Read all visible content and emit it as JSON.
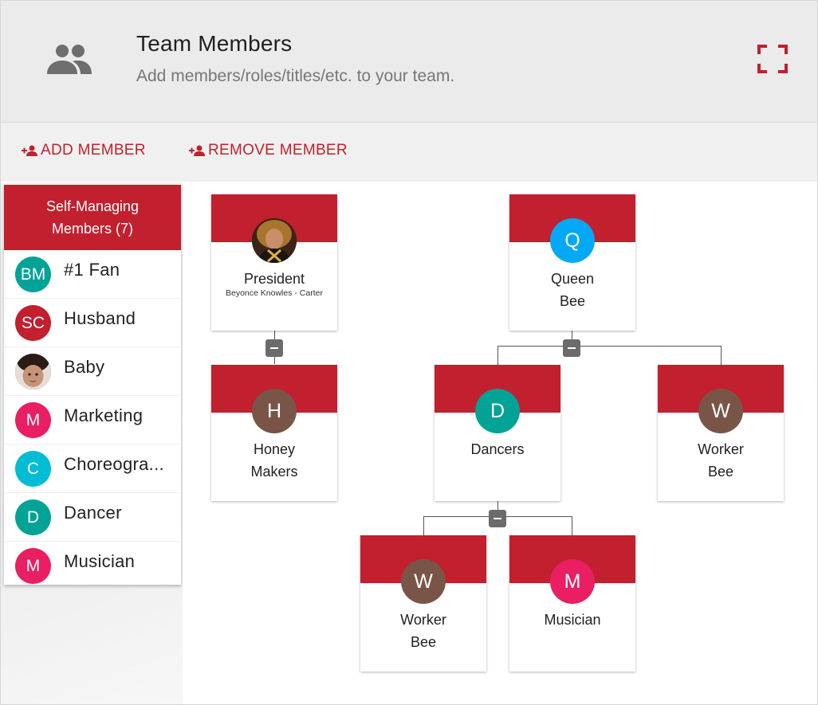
{
  "header": {
    "title": "Team Members",
    "subtitle": "Add members/roles/titles/etc. to your team.",
    "icon": "group-icon",
    "fullscreen_icon": "fullscreen-icon"
  },
  "toolbar": {
    "add_label": "ADD MEMBER",
    "remove_label": "REMOVE MEMBER"
  },
  "sidebar": {
    "title_line1": "Self-Managing",
    "title_line2": "Members (7)",
    "items": [
      {
        "initials": "BM",
        "label": "#1 Fan",
        "color": "#00a395"
      },
      {
        "initials": "SC",
        "label": "Husband",
        "color": "#c21f2f"
      },
      {
        "initials": "",
        "label": "Baby",
        "color": "#b89c8e"
      },
      {
        "initials": "M",
        "label": "Marketing",
        "color": "#e91e63"
      },
      {
        "initials": "C",
        "label": "Choreogra...",
        "color": "#00bcd4"
      },
      {
        "initials": "D",
        "label": "Dancer",
        "color": "#00a395"
      },
      {
        "initials": "M",
        "label": "Musician",
        "color": "#e91e63"
      }
    ]
  },
  "org": {
    "president": {
      "name": "President",
      "sub": "Beyonce Knowles - Carter"
    },
    "queen": {
      "initials": "Q",
      "line1": "Queen",
      "line2": "Bee",
      "color": "#03a9f4"
    },
    "honey": {
      "initials": "H",
      "line1": "Honey",
      "line2": "Makers",
      "color": "#795548"
    },
    "dancers": {
      "initials": "D",
      "line1": "Dancers",
      "color": "#00a395"
    },
    "worker1": {
      "initials": "W",
      "line1": "Worker",
      "line2": "Bee",
      "color": "#795548"
    },
    "worker2": {
      "initials": "W",
      "line1": "Worker",
      "line2": "Bee",
      "color": "#795548"
    },
    "musician": {
      "initials": "M",
      "line1": "Musician",
      "color": "#e91e63"
    }
  },
  "colors": {
    "accent": "#c21f2f",
    "header_bg": "#ebebeb",
    "toolbar_bg": "#f0f0f0"
  }
}
